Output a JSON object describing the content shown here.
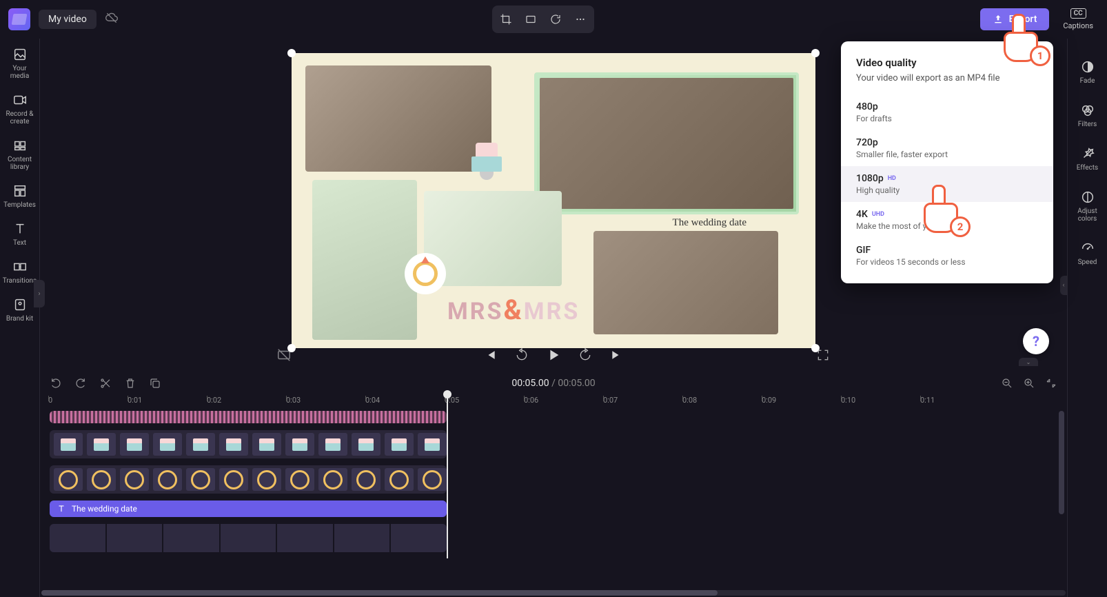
{
  "project": {
    "name": "My video"
  },
  "left_nav": [
    {
      "label": "Your media"
    },
    {
      "label": "Record & create"
    },
    {
      "label": "Content library"
    },
    {
      "label": "Templates"
    },
    {
      "label": "Text"
    },
    {
      "label": "Transitions"
    },
    {
      "label": "Brand kit"
    }
  ],
  "right_nav": [
    {
      "label": "Fade"
    },
    {
      "label": "Filters"
    },
    {
      "label": "Effects"
    },
    {
      "label": "Adjust colors"
    },
    {
      "label": "Speed"
    }
  ],
  "captions_btn": "Captions",
  "export_button": "Export",
  "export_panel": {
    "title": "Video quality",
    "subtitle": "Your video will export as an MP4 file",
    "options": [
      {
        "label": "480p",
        "desc": "For drafts",
        "badge": ""
      },
      {
        "label": "720p",
        "desc": "Smaller file, faster export",
        "badge": ""
      },
      {
        "label": "1080p",
        "desc": "High quality",
        "badge": "HD"
      },
      {
        "label": "4K",
        "desc": "Make the most of your…",
        "badge": "UHD"
      },
      {
        "label": "GIF",
        "desc": "For videos 15 seconds or less",
        "badge": ""
      }
    ]
  },
  "canvas": {
    "caption": "The wedding date",
    "mrs1": "MRS",
    "amp": "&",
    "mrs2": "MRS"
  },
  "playback": {
    "current": "00:05.00",
    "total": "00:05.00"
  },
  "ruler": [
    "0",
    "0:01",
    "0:02",
    "0:03",
    "0:04",
    "0:05",
    "0:06",
    "0:07",
    "0:08",
    "0:09",
    "0:10",
    "0:11"
  ],
  "text_track": {
    "label": "The wedding date"
  },
  "annotations": {
    "step1": "1",
    "step2": "2"
  },
  "help": "?"
}
